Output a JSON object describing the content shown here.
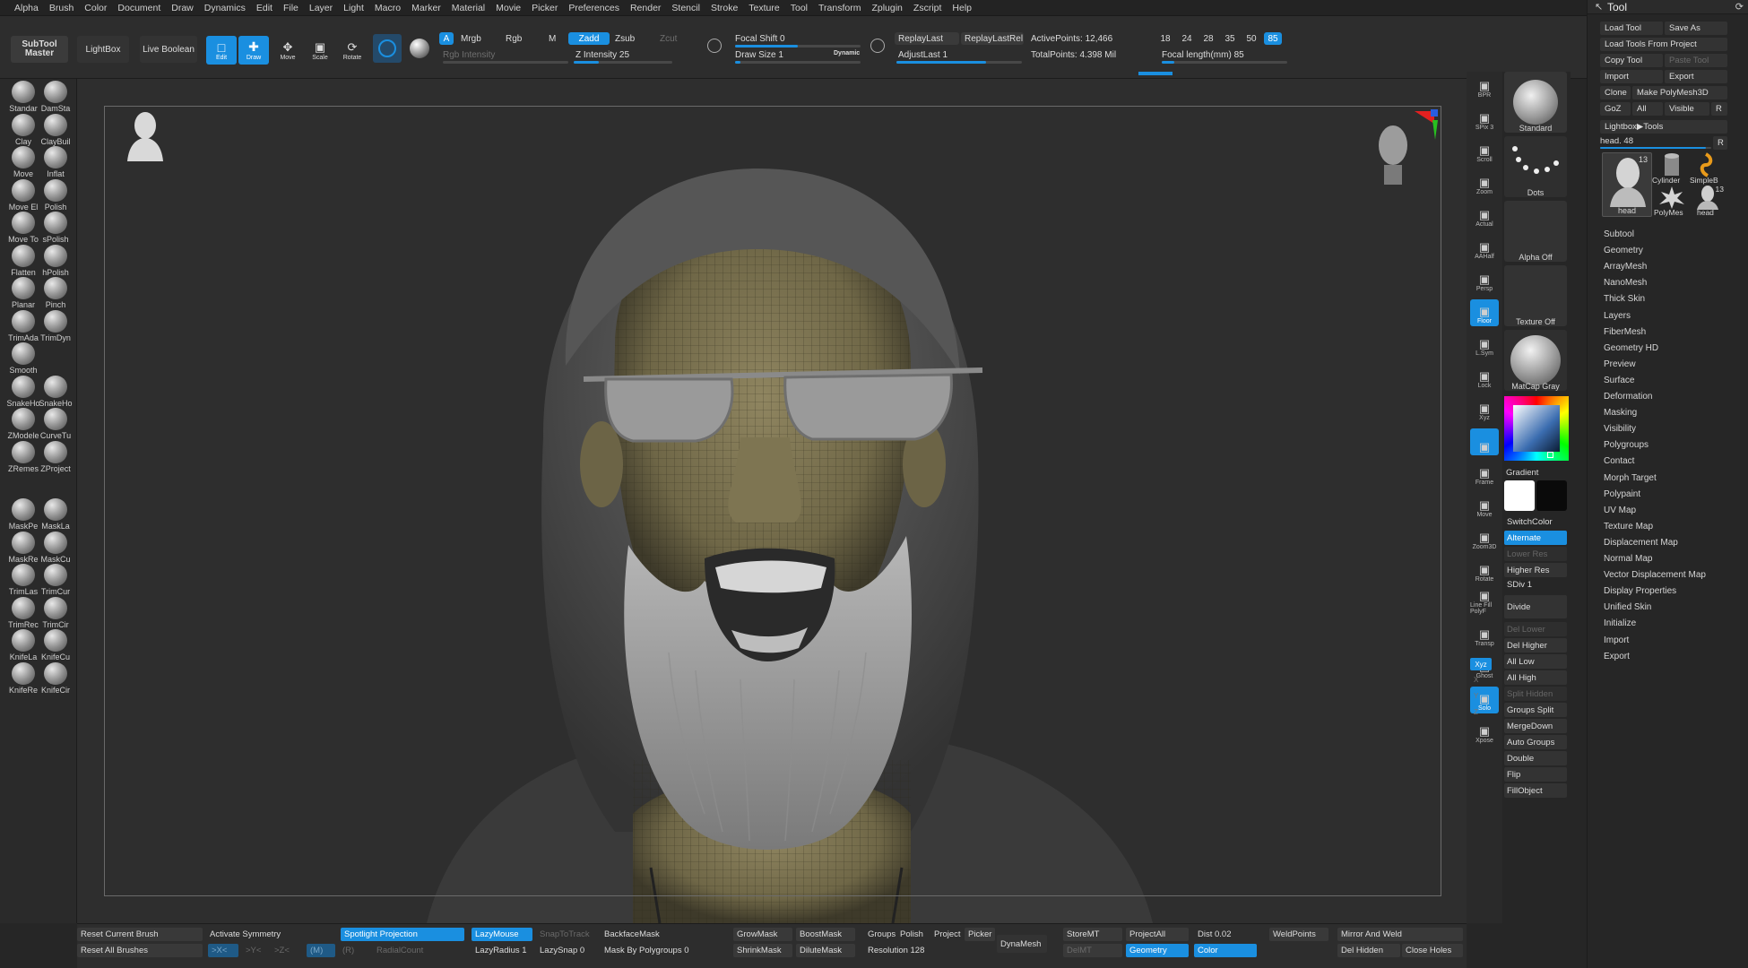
{
  "menu": [
    "Alpha",
    "Brush",
    "Color",
    "Document",
    "Draw",
    "Dynamics",
    "Edit",
    "File",
    "Layer",
    "Light",
    "Macro",
    "Marker",
    "Material",
    "Movie",
    "Picker",
    "Preferences",
    "Render",
    "Stencil",
    "Stroke",
    "Texture",
    "Tool",
    "Transform",
    "Zplugin",
    "Zscript",
    "Help"
  ],
  "toolbar": {
    "subtool_master": "SubTool\nMaster",
    "lightbox": "LightBox",
    "live_boolean": "Live Boolean",
    "edit": "Edit",
    "draw": "Draw",
    "move": "Move",
    "scale": "Scale",
    "rotate": "Rotate",
    "a": "A",
    "mrgb": "Mrgb",
    "rgb": "Rgb",
    "m": "M",
    "rgb_intensity": "Rgb Intensity",
    "zadd": "Zadd",
    "zsub": "Zsub",
    "zcut": "Zcut",
    "z_intensity": "Z Intensity 25",
    "focal_shift": "Focal Shift 0",
    "draw_size": "Draw Size 1",
    "dynamic": "Dynamic",
    "replay_last": "ReplayLast",
    "replay_last_rel": "ReplayLastRel",
    "adjust_last": "AdjustLast 1",
    "active_points": "ActivePoints: 12,466",
    "total_points": "TotalPoints: 4.398 Mil",
    "focal_presets": [
      "18",
      "24",
      "28",
      "35",
      "50",
      "85"
    ],
    "focal_active": "85",
    "focal_length": "Focal length(mm) 85",
    "z_intensity_fill": 0.25,
    "focal_shift_fill": 0.5
  },
  "brushes": [
    [
      "Standar",
      "DamSta"
    ],
    [
      "Clay",
      "ClayBuil"
    ],
    [
      "Move",
      "Inflat"
    ],
    [
      "Move El",
      "Polish"
    ],
    [
      "Move To",
      "sPolish"
    ],
    [
      "Flatten",
      "hPolish"
    ],
    [
      "Planar",
      "Pinch"
    ],
    [
      "TrimAda",
      "TrimDyn"
    ],
    [
      "Smooth",
      ""
    ],
    [
      "SnakeHo",
      "SnakeHo"
    ],
    [
      "ZModele",
      "CurveTu"
    ],
    [
      "ZRemes",
      "ZProject"
    ],
    [
      "MaskPe",
      "MaskLa"
    ],
    [
      "MaskRe",
      "MaskCu"
    ],
    [
      "TrimLas",
      "TrimCur"
    ],
    [
      "TrimRec",
      "TrimCir"
    ],
    [
      "KnifeLa",
      "KnifeCu"
    ],
    [
      "KnifeRe",
      "KnifeCir"
    ]
  ],
  "right_shelf": [
    "BPR",
    "SPix 3",
    "Scroll",
    "Zoom",
    "Actual",
    "AAHalf",
    "Persp",
    "Floor",
    "L.Sym",
    "Lock",
    "Xyz",
    "",
    "Frame",
    "Move",
    "Zoom3D",
    "Rotate",
    "Line Fill PolyF",
    "Transp",
    "Ghost",
    "Solo",
    "Xpose"
  ],
  "material_col": {
    "brush": "Standard",
    "stroke": "Dots",
    "alpha": "Alpha Off",
    "texture": "Texture Off",
    "material": "MatCap Gray",
    "gradient": "Gradient",
    "switch_color": "SwitchColor",
    "alternate": "Alternate",
    "lower_res": "Lower Res",
    "higher_res": "Higher Res",
    "sdiv": "SDiv 1",
    "divide": "Divide",
    "del_lower": "Del Lower",
    "del_higher": "Del Higher",
    "all_low": "All Low",
    "all_high": "All High",
    "split_hidden": "Split Hidden",
    "groups_split": "Groups Split",
    "merge_down": "MergeDown",
    "auto_groups": "Auto Groups",
    "double": "Double",
    "flip": "Flip",
    "fill_object": "FillObject",
    "xyz": "Xyz",
    "x": "X",
    "y": "Y",
    "z": "Z"
  },
  "tool": {
    "title": "Tool",
    "load_tool": "Load Tool",
    "save_as": "Save As",
    "load_from_project": "Load Tools From Project",
    "copy_tool": "Copy Tool",
    "paste_tool": "Paste Tool",
    "import": "Import",
    "export": "Export",
    "clone": "Clone",
    "make_polymesh": "Make PolyMesh3D",
    "goz": "GoZ",
    "all": "All",
    "visible": "Visible",
    "r": "R",
    "lightbox_tools": "Lightbox▶Tools",
    "head_slider": "head. 48",
    "thumbs": [
      {
        "label": "head",
        "count": "13"
      },
      {
        "label": "Cylinder",
        "count": ""
      },
      {
        "label": "SimpleB",
        "count": ""
      },
      {
        "label": "PolyMes",
        "count": ""
      },
      {
        "label": "head",
        "count": "13"
      }
    ],
    "sections": [
      "Subtool",
      "Geometry",
      "ArrayMesh",
      "NanoMesh",
      "Thick Skin",
      "Layers",
      "FiberMesh",
      "Geometry HD",
      "Preview",
      "Surface",
      "Deformation",
      "Masking",
      "Visibility",
      "Polygroups",
      "Contact",
      "Morph Target",
      "Polypaint",
      "UV Map",
      "Texture Map",
      "Displacement Map",
      "Normal Map",
      "Vector Displacement Map",
      "Display Properties",
      "Unified Skin",
      "Initialize",
      "Import",
      "Export"
    ]
  },
  "bottom": {
    "reset_current_brush": "Reset Current Brush",
    "reset_all_brushes": "Reset All Brushes",
    "activate_symmetry": "Activate Symmetry",
    "x_sym": ">X<",
    "y_sym": ">Y<",
    "z_sym": ">Z<",
    "m_sym": "(M)",
    "r_sym": "(R)",
    "radial_count": "RadialCount",
    "spotlight_projection": "Spotlight Projection",
    "lazy_mouse": "LazyMouse",
    "snap_to_track": "SnapToTrack",
    "lazy_radius": "LazyRadius 1",
    "lazy_snap": "LazySnap 0",
    "backface_mask": "BackfaceMask",
    "mask_by_polygroups": "Mask By Polygroups 0",
    "grow_mask": "GrowMask",
    "boost_mask": "BoostMask",
    "shrink_mask": "ShrinkMask",
    "dilute_mask": "DiluteMask",
    "groups": "Groups",
    "polish": "Polish",
    "project": "Project",
    "picker": "Picker",
    "resolution": "Resolution 128",
    "dynamesh": "DynaMesh",
    "store_mt": "StoreMT",
    "del_mt": "DelMT",
    "project_all": "ProjectAll",
    "geometry": "Geometry",
    "dist": "Dist 0.02",
    "color": "Color",
    "weld_points": "WeldPoints",
    "mirror_and_weld": "Mirror And Weld",
    "del_hidden": "Del Hidden",
    "close_holes": "Close Holes"
  },
  "colors": {
    "accent": "#1a8fe0",
    "bg": "#262626",
    "panel": "#2d2d2d"
  }
}
